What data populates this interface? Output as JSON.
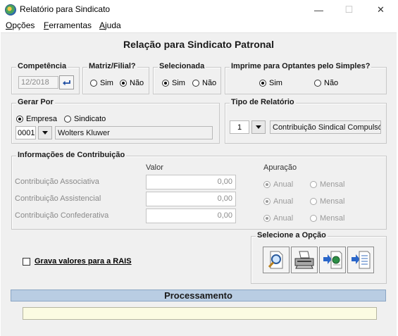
{
  "window": {
    "title": "Relatório para Sindicato",
    "minimize": "—",
    "maximize": "☐",
    "close": "✕"
  },
  "menu": [
    {
      "first": "O",
      "rest": "pções"
    },
    {
      "first": "F",
      "rest": "erramentas"
    },
    {
      "first": "A",
      "rest": "juda"
    }
  ],
  "page_title": "Relação para Sindicato Patronal",
  "competencia": {
    "label": "Competência",
    "value": "12/2018"
  },
  "matriz_filial": {
    "label": "Matriz/Filial?",
    "sim": "Sim",
    "nao": "Não",
    "selected": "nao"
  },
  "selecionada": {
    "label": "Selecionada",
    "sim": "Sim",
    "nao": "Não",
    "selected": "sim"
  },
  "optantes_simples": {
    "label": "Imprime para Optantes pelo Simples?",
    "sim": "Sim",
    "nao": "Não",
    "selected": "sim"
  },
  "gerar_por": {
    "label": "Gerar Por",
    "empresa": "Empresa",
    "sindicato": "Sindicato",
    "selected": "empresa",
    "code": "0001",
    "name": "Wolters Kluwer"
  },
  "tipo_relatorio": {
    "label": "Tipo de Relatório",
    "code": "1",
    "description": "Contribuição Sindical Compulsóri"
  },
  "contribuicao": {
    "label": "Informações de Contribuição",
    "valor_header": "Valor",
    "apuracao_header": "Apuração",
    "anual": "Anual",
    "mensal": "Mensal",
    "rows": [
      {
        "label": "Contribuição Associativa",
        "value": "0,00"
      },
      {
        "label": "Contribuição Assistencial",
        "value": "0,00"
      },
      {
        "label": "Contribuição Confederativa",
        "value": "0,00"
      }
    ]
  },
  "opcoes": {
    "label": "Selecione a Opção"
  },
  "rais": {
    "label": "Grava valores para a RAIS",
    "checked": false
  },
  "processamento": {
    "label": "Processamento"
  }
}
